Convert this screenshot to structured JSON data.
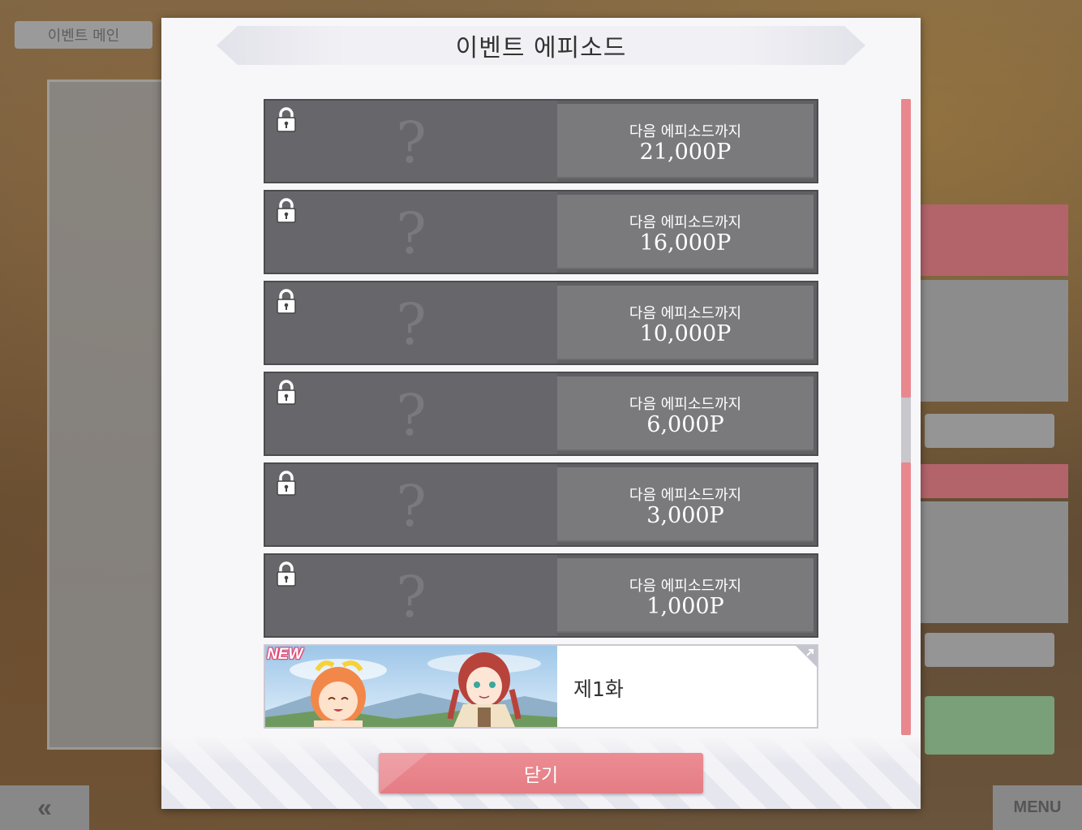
{
  "background": {
    "left_title": "이벤트 메인",
    "back_button": "«",
    "menu_button": "MENU"
  },
  "modal": {
    "title": "이벤트 에피소드",
    "locked_episodes": [
      {
        "label": "다음 에피소드까지",
        "points": "21,000P"
      },
      {
        "label": "다음 에피소드까지",
        "points": "16,000P"
      },
      {
        "label": "다음 에피소드까지",
        "points": "10,000P"
      },
      {
        "label": "다음 에피소드까지",
        "points": "6,000P"
      },
      {
        "label": "다음 에피소드까지",
        "points": "3,000P"
      },
      {
        "label": "다음 에피소드까지",
        "points": "1,000P"
      }
    ],
    "locked_placeholder": "?",
    "open_episode": {
      "badge": "NEW",
      "name": "제1화"
    },
    "close_label": "닫기"
  },
  "colors": {
    "accent_pink": "#e8888e",
    "locked_row": "#5f5f64",
    "locked_points_panel": "#7a7a7d",
    "new_badge": "#e4426f"
  }
}
